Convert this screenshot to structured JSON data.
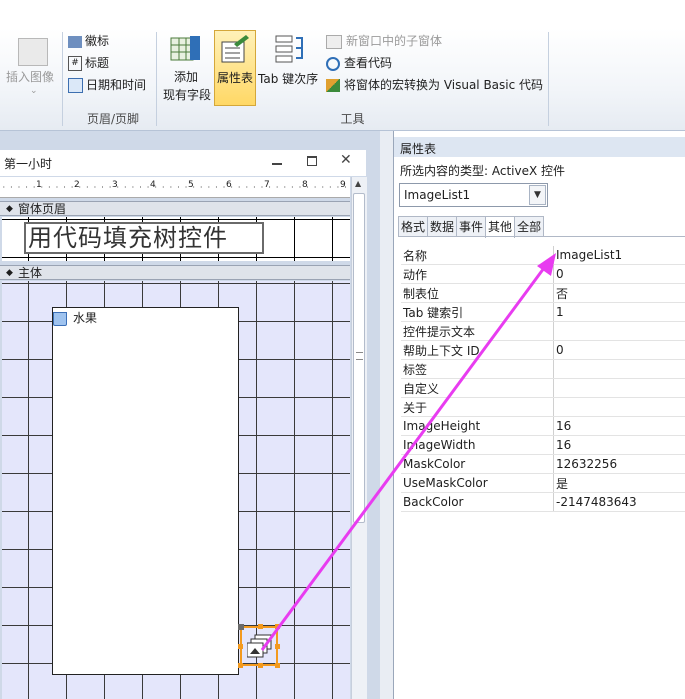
{
  "ribbon": {
    "insert_image": "插入图像",
    "logo": "徽标",
    "title": "标题",
    "datetime": "日期和时间",
    "header_footer_group": "页眉/页脚",
    "add_existing_fields": [
      "添加",
      "现有字段"
    ],
    "property_sheet": "属性表",
    "tab_order": "Tab 键次序",
    "subform_new_window": "新窗口中的子窗体",
    "view_code": "查看代码",
    "convert_macros": "将窗体的宏转换为 Visual Basic 代码",
    "tools_group": "工具"
  },
  "form": {
    "window_title": "第一小时",
    "ruler_numbers": [
      "1",
      "2",
      "3",
      "4",
      "5",
      "6",
      "7",
      "8",
      "9"
    ],
    "header_section": "窗体页眉",
    "header_label": "用代码填充树控件",
    "detail_section": "主体",
    "tree_item": "水果"
  },
  "property_sheet": {
    "title": "属性表",
    "selection_type": "所选内容的类型: ActiveX 控件",
    "selected_object": "ImageList1",
    "tabs": [
      "格式",
      "数据",
      "事件",
      "其他",
      "全部"
    ],
    "active_tab": "其他",
    "rows": [
      [
        "名称",
        "ImageList1"
      ],
      [
        "动作",
        "0"
      ],
      [
        "制表位",
        "否"
      ],
      [
        "Tab 键索引",
        "1"
      ],
      [
        "控件提示文本",
        ""
      ],
      [
        "帮助上下文 ID",
        "0"
      ],
      [
        "标签",
        ""
      ],
      [
        "自定义",
        ""
      ],
      [
        "关于",
        ""
      ],
      [
        "ImageHeight",
        "16"
      ],
      [
        "ImageWidth",
        "16"
      ],
      [
        "MaskColor",
        "12632256"
      ],
      [
        "UseMaskColor",
        "是"
      ],
      [
        "BackColor",
        "-2147483643"
      ]
    ]
  },
  "colors": {
    "annotation_arrow": "#e83cf0",
    "selection_handle": "#f39a1e",
    "detail_grid_bg": "#e4e6fb"
  }
}
